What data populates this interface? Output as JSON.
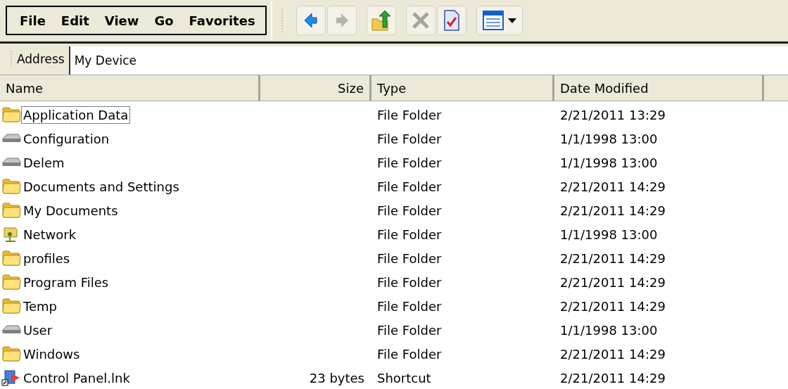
{
  "menu": [
    "File",
    "Edit",
    "View",
    "Go",
    "Favorites"
  ],
  "address": {
    "label": "Address",
    "value": "My Device"
  },
  "columns": [
    "Name",
    "Size",
    "Type",
    "Date Modified"
  ],
  "rows": [
    {
      "kind": "folder",
      "name": "Application Data",
      "size": "",
      "type": "File Folder",
      "date": "2/21/2011 13:29",
      "focused": true
    },
    {
      "kind": "drive",
      "name": "Configuration",
      "type": "File Folder",
      "date": "1/1/1998 13:00",
      "focused": false
    },
    {
      "kind": "drive",
      "name": "Delem",
      "type": "File Folder",
      "date": "1/1/1998 13:00",
      "focused": false
    },
    {
      "kind": "folder",
      "name": "Documents and Settings",
      "type": "File Folder",
      "date": "2/21/2011 14:29",
      "focused": false
    },
    {
      "kind": "folder",
      "name": "My Documents",
      "type": "File Folder",
      "date": "2/21/2011 14:29",
      "focused": false
    },
    {
      "kind": "network",
      "name": "Network",
      "type": "File Folder",
      "date": "1/1/1998 13:00",
      "focused": false
    },
    {
      "kind": "folder",
      "name": "profiles",
      "type": "File Folder",
      "date": "2/21/2011 14:29",
      "focused": false
    },
    {
      "kind": "folder",
      "name": "Program Files",
      "type": "File Folder",
      "date": "2/21/2011 14:29",
      "focused": false
    },
    {
      "kind": "folder",
      "name": "Temp",
      "type": "File Folder",
      "date": "2/21/2011 14:29",
      "focused": false
    },
    {
      "kind": "drive",
      "name": "User",
      "type": "File Folder",
      "date": "1/1/1998 13:00",
      "focused": false
    },
    {
      "kind": "folder",
      "name": "Windows",
      "type": "File Folder",
      "date": "2/21/2011 14:29",
      "focused": false
    },
    {
      "kind": "shortcut",
      "name": "Control Panel.lnk",
      "size": "23 bytes",
      "type": "Shortcut",
      "date": "2/21/2011 14:29",
      "focused": false
    }
  ]
}
